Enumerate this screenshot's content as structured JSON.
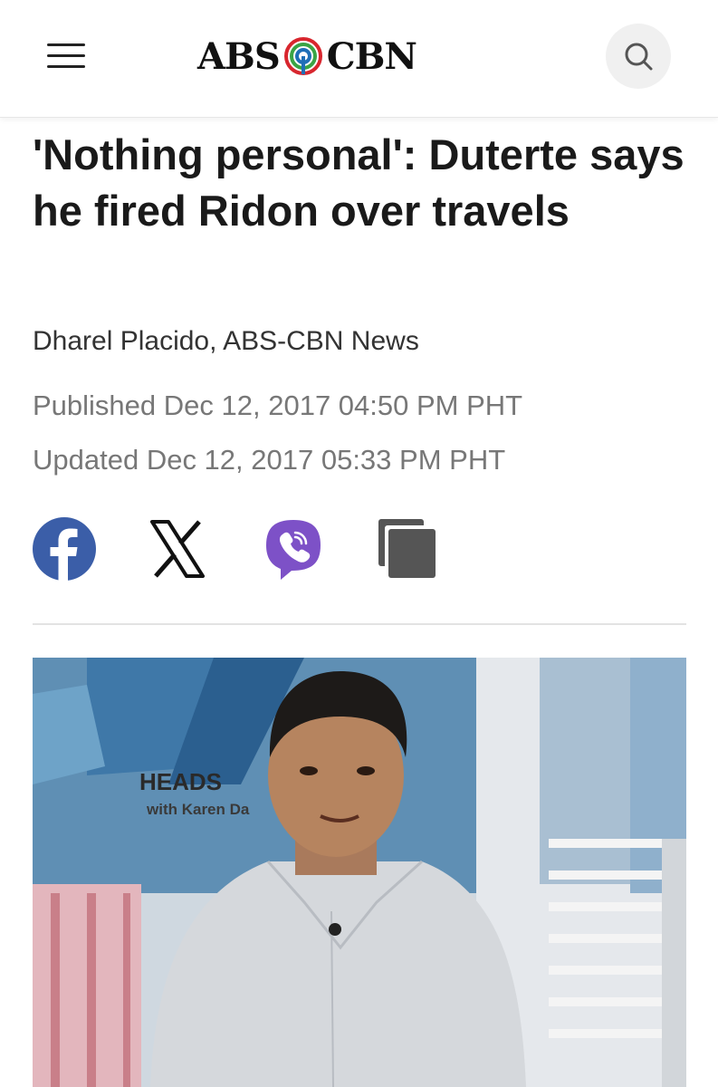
{
  "header": {
    "logo_left": "ABS",
    "logo_right": "CBN",
    "menu_icon": "hamburger-menu-icon",
    "search_icon": "search-icon"
  },
  "article": {
    "headline": "'Nothing personal': Duterte says he fired Ridon over travels",
    "byline": "Dharel Placido, ABS-CBN News",
    "published": "Published Dec 12, 2017 04:50 PM PHT",
    "updated": "Updated Dec 12, 2017 05:33 PM PHT"
  },
  "share": {
    "icons": [
      "facebook-icon",
      "x-icon",
      "viber-icon",
      "copy-link-icon"
    ],
    "facebook_color": "#3b5ea8",
    "viber_color": "#7d51c7",
    "copy_color": "#555555"
  },
  "photo": {
    "studio_text_1": "HEADS",
    "studio_text_2": "with Karen Da"
  },
  "colors": {
    "text": "#1a1a1a",
    "meta_text": "#777777",
    "logo_red": "#d8262e",
    "logo_green": "#3aa445",
    "logo_blue": "#1f6fb7"
  }
}
